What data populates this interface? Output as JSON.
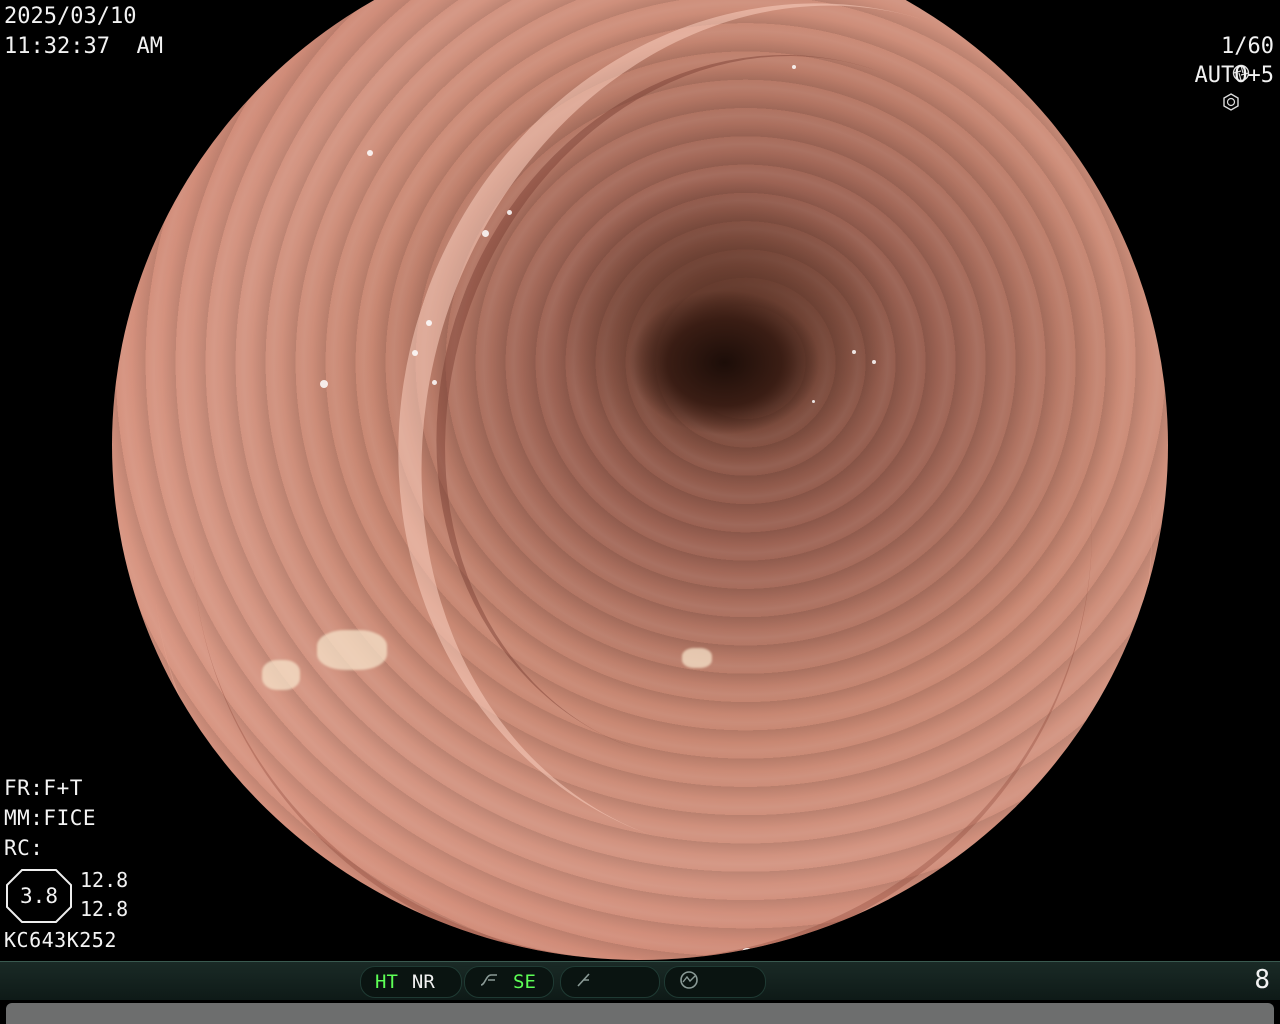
{
  "overlay": {
    "date": "2025/03/10",
    "time": "11:32:37  AM",
    "shutter": "1/60",
    "iris": "AUTO+5",
    "fr": "FR:F+T",
    "mm": "MM:FICE",
    "rc": "RC:",
    "octagon_value": "3.8",
    "side_value_1": "12.8",
    "side_value_2": "12.8",
    "scope_id": "KC643K252"
  },
  "statusbar": {
    "ht": "HT",
    "nr": "NR",
    "se": "SE",
    "page": "8"
  },
  "icons": {
    "shutter": "aperture-icon",
    "iris": "iris-icon",
    "curve": "tone-curve-icon",
    "enhance": "enhance-icon",
    "circle": "dial-icon"
  }
}
